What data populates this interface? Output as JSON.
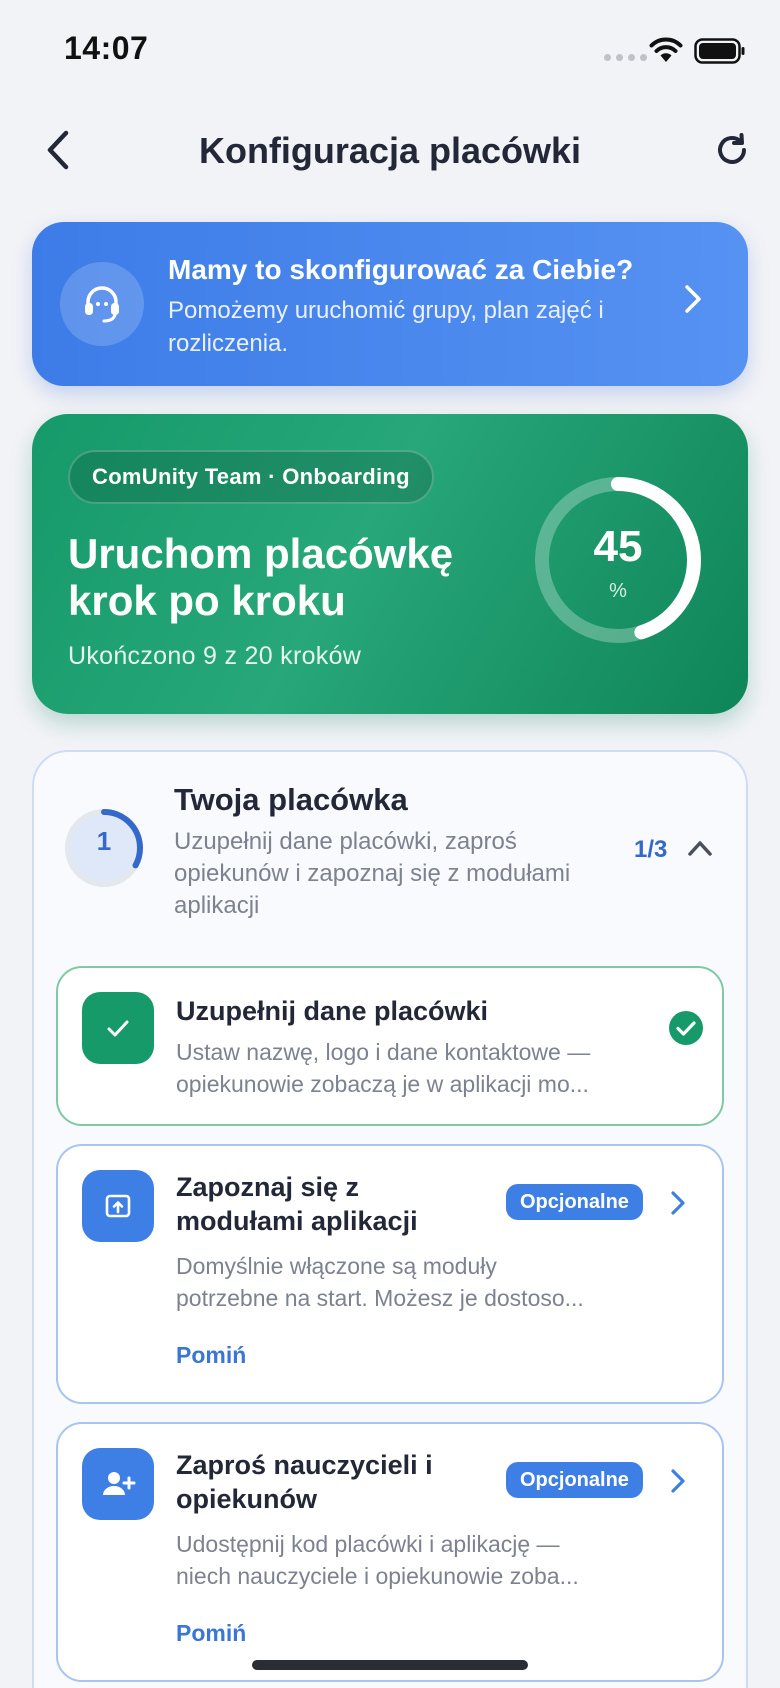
{
  "status_bar": {
    "time": "14:07"
  },
  "header": {
    "title": "Konfiguracja placówki"
  },
  "help_banner": {
    "title": "Mamy to skonfigurować za Ciebie?",
    "subtitle": "Pomożemy uruchomić grupy, plan zajęć i rozliczenia."
  },
  "progress": {
    "chip": "ComUnity Team · Onboarding",
    "title": "Uruchom placówkę krok po kroku",
    "steps_text": "Ukończono 9 z 20 kroków",
    "percent": 45,
    "percent_label": "45",
    "unit": "%"
  },
  "section": {
    "number": "1",
    "title": "Twoja placówka",
    "description": "Uzupełnij dane placówki, zaproś opiekunów i zapoznaj się z modułami aplikacji",
    "progress_text": "1/3",
    "progress_fraction": 0.33,
    "tasks": [
      {
        "title": "Uzupełnij dane placówki",
        "desc_line1": "Ustaw nazwę, logo i dane kontaktowe —",
        "desc_line2": "opiekunowie zobaczą je w aplikacji mo...",
        "status": "done",
        "icon": "check-icon"
      },
      {
        "title_line1": "Zapoznaj się z",
        "title_line2": "modułami aplikacji",
        "badge": "Opcjonalne",
        "desc_line1": "Domyślnie włączone są moduły",
        "desc_line2": "potrzebne na start. Możesz je dostoso...",
        "skip": "Pomiń",
        "icon": "modules-icon"
      },
      {
        "title_line1": "Zaproś nauczycieli i",
        "title_line2": "opiekunów",
        "badge": "Opcjonalne",
        "desc_line1": "Udostępnij kod placówki i aplikację —",
        "desc_line2": "niech nauczyciele i opiekunowie zoba...",
        "skip": "Pomiń",
        "icon": "add-user-icon"
      }
    ]
  },
  "colors": {
    "accent_blue": "#3e7fe6",
    "brand_green": "#179a6a",
    "background": "#f2f3f7"
  }
}
